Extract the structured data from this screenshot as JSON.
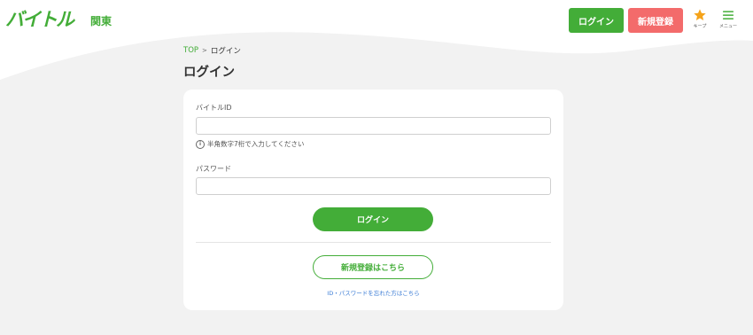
{
  "header": {
    "logo_text": "バイトル",
    "region": "関東",
    "login_label": "ログイン",
    "register_label": "新規登録",
    "keep_caption": "キープ",
    "menu_caption": "メニュー"
  },
  "breadcrumb": {
    "top": "TOP",
    "separator": ">",
    "current": "ログイン"
  },
  "page_title": "ログイン",
  "form": {
    "id_label": "バイトルID",
    "id_value": "",
    "id_hint_icon": "i",
    "id_hint": "半角数字7桁で入力してください",
    "password_label": "パスワード",
    "password_value": "",
    "submit_label": "ログイン",
    "register_label": "新規登録はこちら",
    "forgot_link": "ID・パスワードを忘れた方はこちら"
  },
  "icons": {
    "keep": "star-icon",
    "menu": "hamburger-icon",
    "hint": "info-circle-icon"
  },
  "colors": {
    "brand_green": "#43ad38",
    "register_red": "#f36b6b",
    "star_orange": "#f5a31a",
    "background_gray": "#f2f2f2",
    "link_blue": "#3a7bd5"
  }
}
